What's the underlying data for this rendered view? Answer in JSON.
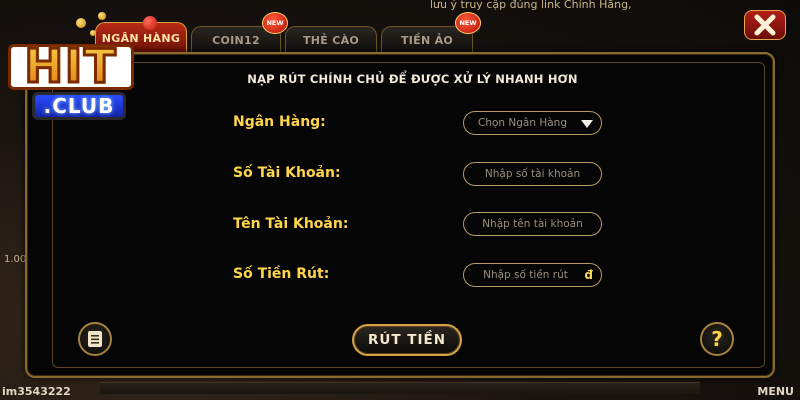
{
  "background": {
    "marquee_text": "lưu ý truy cập đúng link Chính Hãng,",
    "left_number": "1.00",
    "username": "im3543222",
    "menu_label": "MENU"
  },
  "tabs": [
    {
      "label": "NGÂN HÀNG",
      "active": true
    },
    {
      "label": "COIN12",
      "active": false,
      "badge": "NEW"
    },
    {
      "label": "THẺ CÀO",
      "active": false
    },
    {
      "label": "TIỀN ẢO",
      "active": false,
      "badge": "NEW"
    }
  ],
  "logo": {
    "top": "HIT",
    "bottom": ".CLUB"
  },
  "form": {
    "title": "NẠP RÚT CHÍNH CHỦ ĐỂ ĐƯỢC XỬ LÝ NHANH HƠN",
    "bank_label": "Ngân Hàng:",
    "bank_select_placeholder": "Chọn Ngân Hàng",
    "account_number_label": "Số Tài Khoản:",
    "account_number_placeholder": "Nhập số tài  khoản",
    "account_name_label": "Tên Tài Khoản:",
    "account_name_placeholder": "Nhập tên tài khoản",
    "amount_label": "Số Tiền Rút:",
    "amount_placeholder": "Nhập số tiền rút",
    "currency_symbol": "đ"
  },
  "buttons": {
    "withdraw": "RÚT TIỀN",
    "help": "?"
  },
  "colors": {
    "accent_gold": "#ffd54a",
    "tab_active_red": "#b72a16",
    "border_gold": "#8a6a2c"
  }
}
